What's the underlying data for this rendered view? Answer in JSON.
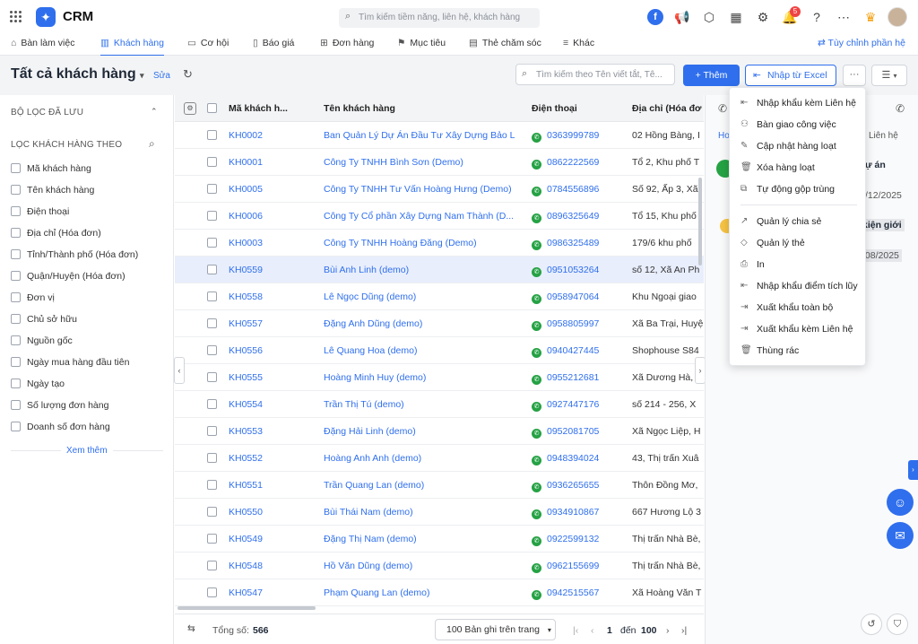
{
  "app": {
    "name": "CRM",
    "search_placeholder": "Tìm kiếm tiềm năng, liên hệ, khách hàng",
    "notification_count": "5"
  },
  "nav": {
    "items": [
      {
        "label": "Bàn làm việc",
        "icon": "home-icon"
      },
      {
        "label": "Khách hàng",
        "icon": "building-icon"
      },
      {
        "label": "Cơ hội",
        "icon": "briefcase-icon"
      },
      {
        "label": "Báo giá",
        "icon": "quote-icon"
      },
      {
        "label": "Đơn hàng",
        "icon": "cart-icon"
      },
      {
        "label": "Mục tiêu",
        "icon": "flag-icon"
      },
      {
        "label": "Thẻ chăm sóc",
        "icon": "card-icon"
      },
      {
        "label": "Khác",
        "icon": "menu-icon"
      }
    ],
    "customize": "Tùy chỉnh phần hệ"
  },
  "toolbar": {
    "title": "Tất cả khách hàng",
    "edit": "Sửa",
    "search_placeholder": "Tìm kiếm theo Tên viết tắt, Tê...",
    "add": "+ Thêm",
    "import": "Nhập từ Excel",
    "more": "···"
  },
  "sidebar": {
    "saved_filters": "BỘ LỌC ĐÃ LƯU",
    "filter_by": "LỌC KHÁCH HÀNG THEO",
    "filters": [
      "Mã khách hàng",
      "Tên khách hàng",
      "Điện thoại",
      "Địa chỉ (Hóa đơn)",
      "Tỉnh/Thành phố (Hóa đơn)",
      "Quận/Huyện (Hóa đơn)",
      "Đơn vị",
      "Chủ sở hữu",
      "Nguồn gốc",
      "Ngày mua hàng đầu tiên",
      "Ngày tạo",
      "Số lượng đơn hàng",
      "Doanh số đơn hàng"
    ],
    "see_more": "Xem thêm"
  },
  "table": {
    "headers": {
      "code": "Mã khách h...",
      "name": "Tên khách hàng",
      "phone": "Điện thoại",
      "address": "Địa chỉ (Hóa đơ"
    },
    "rows": [
      {
        "code": "KH0002",
        "name": "Ban Quản Lý Dự Án Đầu Tư Xây Dựng Bảo L...",
        "phone": "0363999789",
        "address": "02 Hồng Bàng, I"
      },
      {
        "code": "KH0001",
        "name": "Công Ty TNHH Bình Sơn (Demo)",
        "phone": "0862222569",
        "address": "Tổ 2, Khu phố T"
      },
      {
        "code": "KH0005",
        "name": "Công Ty TNHH Tư Vấn Hoàng Hưng (Demo)",
        "phone": "0784556896",
        "address": "Số 92, Ấp 3, Xã"
      },
      {
        "code": "KH0006",
        "name": "Công Ty Cổ phần Xây Dựng Nam Thành (D...",
        "phone": "0896325649",
        "address": "Tổ 15, Khu phố"
      },
      {
        "code": "KH0003",
        "name": "Công Ty TNHH Hoàng Đăng (Demo)",
        "phone": "0986325489",
        "address": "179/6 khu phố"
      },
      {
        "code": "KH0559",
        "name": "Bùi Anh Linh (demo)",
        "phone": "0951053264",
        "address": "số 12, Xã An Ph"
      },
      {
        "code": "KH0558",
        "name": "Lê Ngọc Dũng (demo)",
        "phone": "0958947064",
        "address": "Khu Ngoại giao"
      },
      {
        "code": "KH0557",
        "name": "Đặng Anh Dũng (demo)",
        "phone": "0958805997",
        "address": "Xã Ba Trại, Huyệ"
      },
      {
        "code": "KH0556",
        "name": "Lê Quang Hoa (demo)",
        "phone": "0940427445",
        "address": "Shophouse S84"
      },
      {
        "code": "KH0555",
        "name": "Hoàng Minh Huy (demo)",
        "phone": "0955212681",
        "address": "Xã Dương Hà, H"
      },
      {
        "code": "KH0554",
        "name": "Trần Thị Tú (demo)",
        "phone": "0927447176",
        "address": "số 214 - 256, X"
      },
      {
        "code": "KH0553",
        "name": "Đặng Hải Linh (demo)",
        "phone": "0952081705",
        "address": "Xã Ngọc Liệp, H"
      },
      {
        "code": "KH0552",
        "name": "Hoàng Anh Anh (demo)",
        "phone": "0948394024",
        "address": "43, Thị trấn Xuâ"
      },
      {
        "code": "KH0551",
        "name": "Trần Quang Lan (demo)",
        "phone": "0936265655",
        "address": "Thôn Đồng Mơ,"
      },
      {
        "code": "KH0550",
        "name": "Bùi Thái Nam (demo)",
        "phone": "0934910867",
        "address": "667 Hương Lộ 3"
      },
      {
        "code": "KH0549",
        "name": "Đặng Thị Nam (demo)",
        "phone": "0922599132",
        "address": "Thị trấn Nhà Bè,"
      },
      {
        "code": "KH0548",
        "name": "Hồ Văn Dũng (demo)",
        "phone": "0962155699",
        "address": "Thị trấn Nhà Bè,"
      },
      {
        "code": "KH0547",
        "name": "Phạm Quang Lan (demo)",
        "phone": "0942515567",
        "address": "Xã Hoàng Văn T"
      }
    ],
    "selected_row": 5
  },
  "footer": {
    "total_label": "Tổng số:",
    "total": "566",
    "page_size": "100 Bản ghi trên trang",
    "page_from": "1",
    "page_to_label": "đến",
    "page_to": "100"
  },
  "right_panel": {
    "tab_left": "Ho",
    "tab_right": "Liên hệ",
    "snip1": "ự án",
    "snip2": "/12/2025",
    "snip3": "kiện giới",
    "snip4": "/08/2025"
  },
  "menu": {
    "group1": [
      "Nhập khẩu kèm Liên hệ",
      "Bàn giao công việc",
      "Cập nhật hàng loạt",
      "Xóa hàng loạt",
      "Tự động gộp trùng"
    ],
    "group2": [
      "Quản lý chia sẻ",
      "Quản lý thẻ",
      "In",
      "Nhập khẩu điểm tích lũy",
      "Xuất khẩu toàn bộ",
      "Xuất khẩu kèm Liên hệ",
      "Thùng rác"
    ]
  }
}
